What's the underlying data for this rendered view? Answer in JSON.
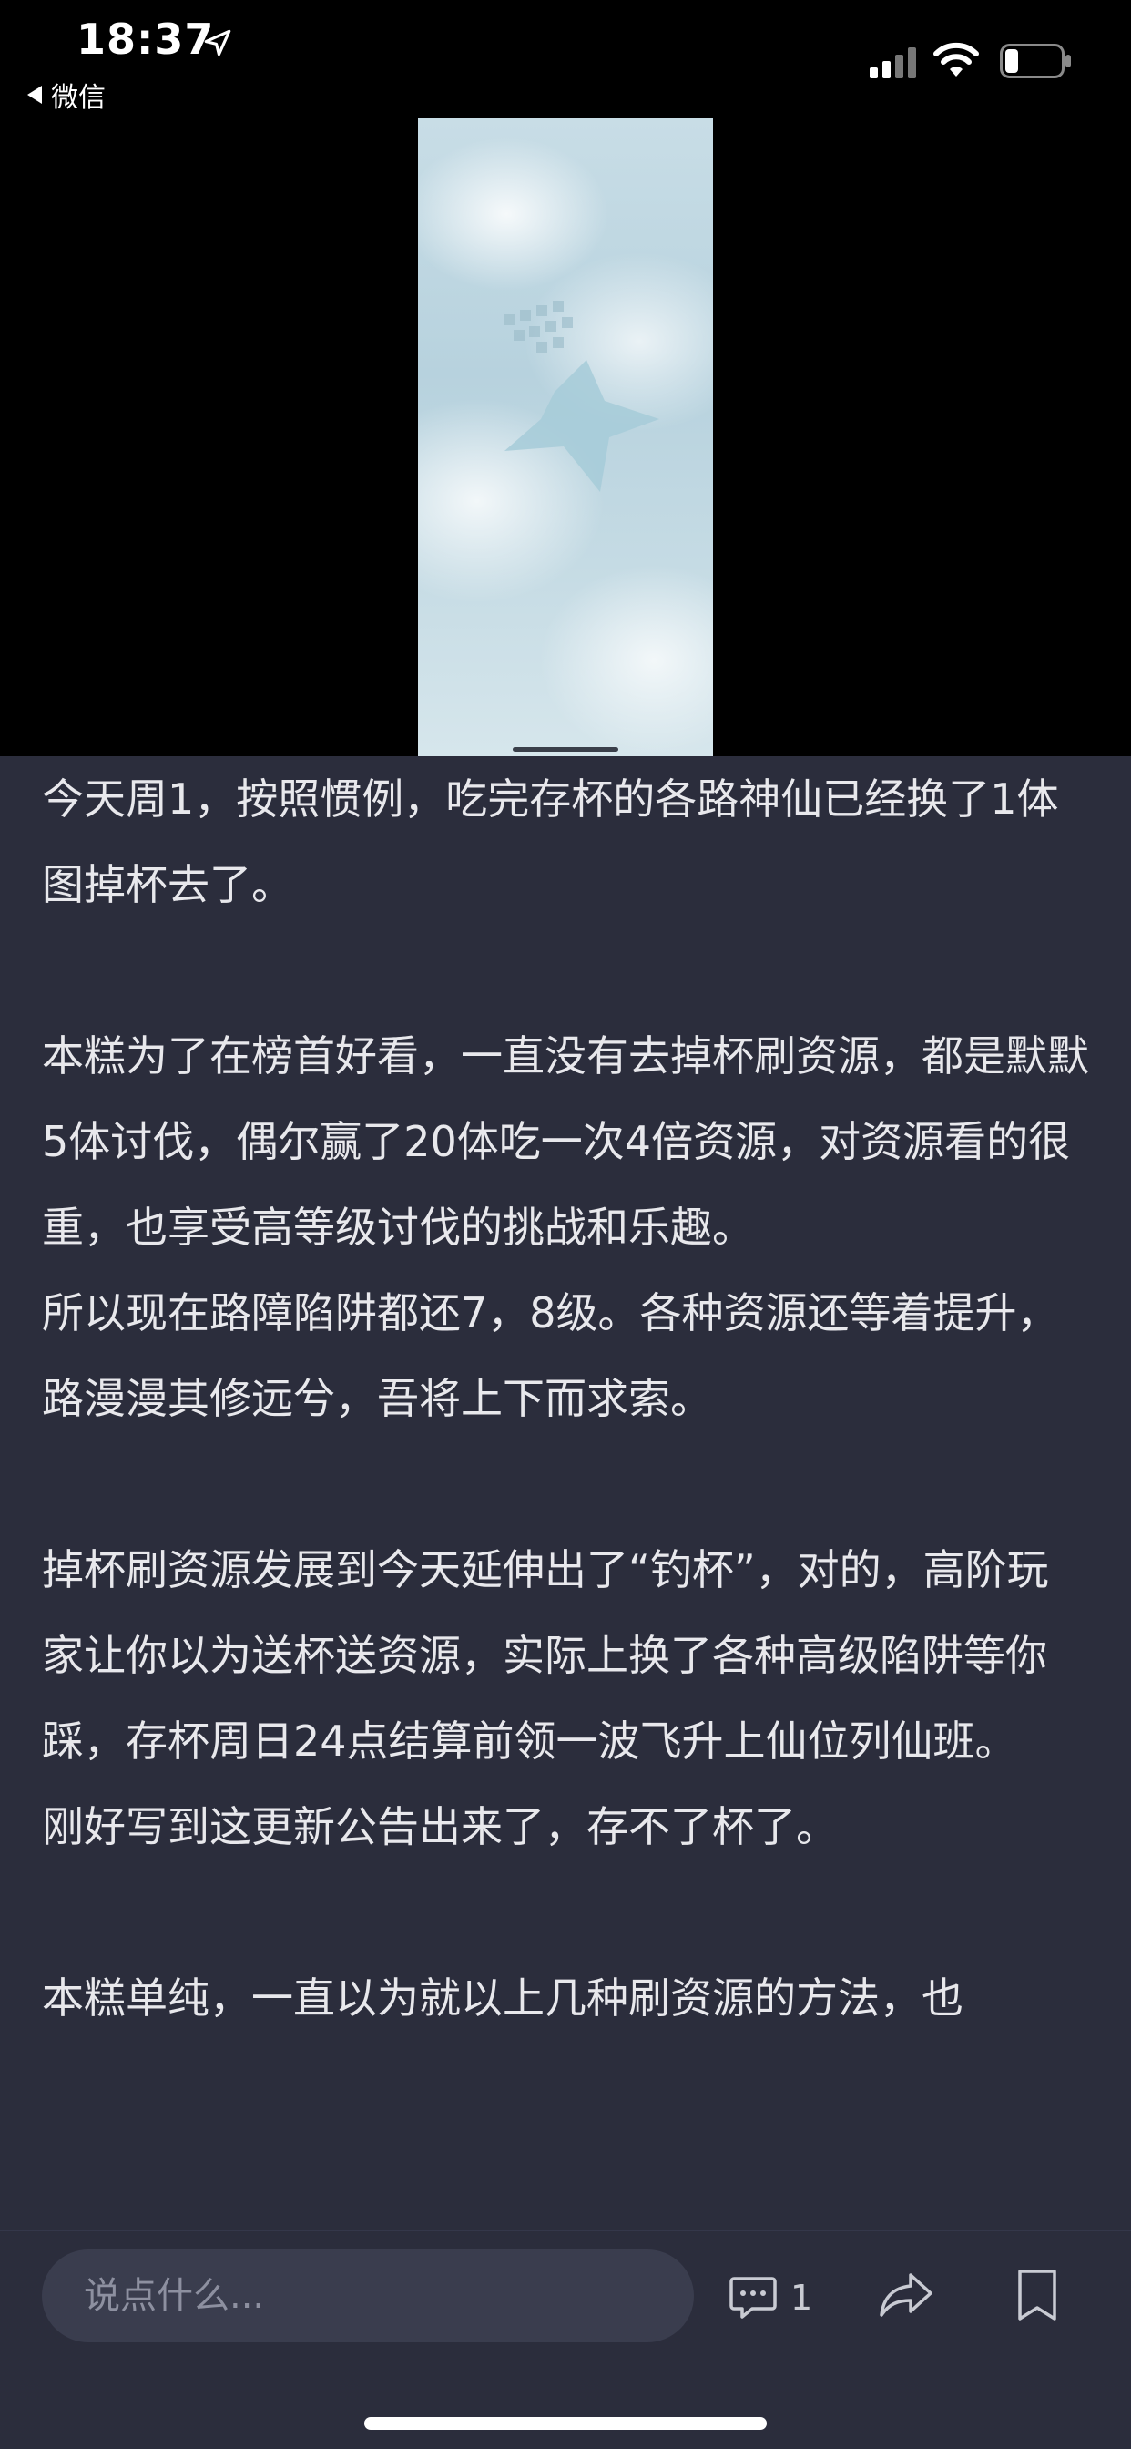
{
  "status_bar": {
    "time": "18:37",
    "back_label": "微信",
    "icons": [
      "location-arrow-icon",
      "signal-icon",
      "wifi-icon",
      "battery-icon"
    ]
  },
  "article": {
    "paragraphs": [
      "今天周1，按照惯例，吃完存杯的各路神仙已经换了1体图掉杯去了。",
      "",
      "本糕为了在榜首好看，一直没有去掉杯刷资源，都是默默5体讨伐，偶尔赢了20体吃一次4倍资源，对资源看的很重，也享受高等级讨伐的挑战和乐趣。",
      "所以现在路障陷阱都还7，8级。各种资源还等着提升，路漫漫其修远兮，吾将上下而求索。",
      "",
      "掉杯刷资源发展到今天延伸出了“钓杯”，对的，高阶玩家让你以为送杯送资源，实际上换了各种高级陷阱等你踩，存杯周日24点结算前领一波飞升上仙位列仙班。",
      "刚好写到这更新公告出来了，存不了杯了。",
      "",
      "本糕单纯，一直以为就以上几种刷资源的方法，也"
    ]
  },
  "bottom_bar": {
    "comment_placeholder": "说点什么...",
    "comment_count": "1",
    "icons": [
      "comment-icon",
      "share-icon",
      "bookmark-icon"
    ]
  },
  "colors": {
    "article_bg": "#2b2d3c",
    "text": "#e8e8ec",
    "input_bg": "#3a3d4e"
  }
}
